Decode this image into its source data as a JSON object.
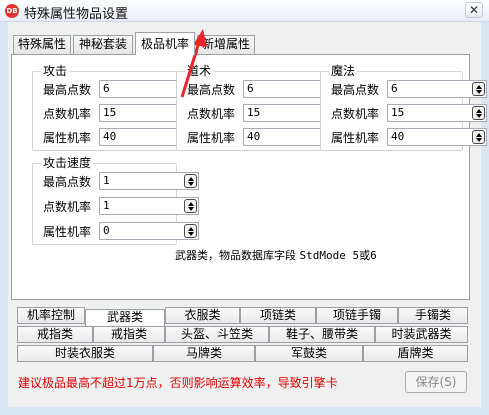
{
  "window": {
    "title": "特殊属性物品设置",
    "app_icon_text": "DB",
    "close_glyph": "✕"
  },
  "tabs": [
    {
      "label": "特殊属性"
    },
    {
      "label": "神秘套装"
    },
    {
      "label": "极品机率"
    },
    {
      "label": "新增属性"
    }
  ],
  "active_tab": "极品机率",
  "groups": {
    "attack": {
      "title": "攻击",
      "max_points": {
        "label": "最高点数",
        "value": "6"
      },
      "points_rate": {
        "label": "点数机率",
        "value": "15"
      },
      "attr_rate": {
        "label": "属性机率",
        "value": "40"
      }
    },
    "taoist": {
      "title": "道术",
      "max_points": {
        "label": "最高点数",
        "value": "6"
      },
      "points_rate": {
        "label": "点数机率",
        "value": "15"
      },
      "attr_rate": {
        "label": "属性机率",
        "value": "40"
      }
    },
    "magic": {
      "title": "魔法",
      "max_points": {
        "label": "最高点数",
        "value": "6"
      },
      "points_rate": {
        "label": "点数机率",
        "value": "15"
      },
      "attr_rate": {
        "label": "属性机率",
        "value": "40"
      }
    },
    "attack_speed": {
      "title": "攻击速度",
      "max_points": {
        "label": "最高点数",
        "value": "1"
      },
      "points_rate": {
        "label": "点数机率",
        "value": "1"
      },
      "attr_rate": {
        "label": "属性机率",
        "value": "0"
      }
    }
  },
  "info_note": {
    "prefix": "武器类，物品数据库字段 ",
    "code": "StdMode 5或6"
  },
  "category_tabs": {
    "row1": [
      "机率控制",
      "武器类",
      "衣服类",
      "项链类",
      "项链手镯",
      "手镯类"
    ],
    "row2": [
      "戒指类",
      "戒指类",
      "头盔、斗笠类",
      "鞋子、腰带类",
      "时装武器类"
    ],
    "row3": [
      "时装衣服类",
      "马牌类",
      "军鼓类",
      "盾牌类"
    ]
  },
  "active_category": "武器类",
  "warning": "建议极品最高不超过1万点，否则影响运算效率，导致引擎卡",
  "save_button": "保存(S)",
  "colors": {
    "warning": "#e00000",
    "annotation_arrow": "#e8262b"
  }
}
